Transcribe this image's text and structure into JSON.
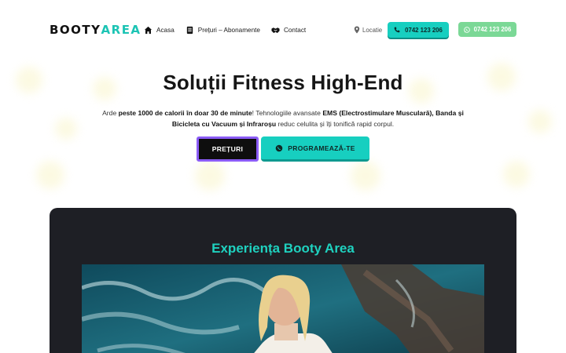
{
  "logo": {
    "part1": "BOOTY",
    "part2": "AREA"
  },
  "nav": [
    {
      "label": "Acasa",
      "icon": "home-icon"
    },
    {
      "label": "Prețuri – Abonamente",
      "icon": "document-icon"
    },
    {
      "label": "Contact",
      "icon": "handshake-icon"
    }
  ],
  "header": {
    "location_label": "Locatie",
    "phone_label": "0742 123 206",
    "whatsapp_label": "0742 123 206"
  },
  "hero": {
    "title": "Soluții Fitness High-End",
    "text_1": "Arde ",
    "text_2": "peste 1000 de calorii în doar 30 de minute",
    "text_3": "! Tehnologiile avansate ",
    "text_4": "EMS (Electrostimulare Musculară), Banda și Bicicleta cu Vacuum și Infraroșu",
    "text_5": " reduc celulita și îți tonifică rapid corpul.",
    "btn_preturi": "PREȚURI",
    "btn_program": "PROGRAMEAZĂ-TE"
  },
  "experience": {
    "title": "Experiența Booty Area"
  },
  "colors": {
    "accent_teal": "#17cfc0",
    "accent_purple": "#8b5cf6",
    "whatsapp_green": "#7bd896",
    "dark_panel": "#1e1f25"
  }
}
